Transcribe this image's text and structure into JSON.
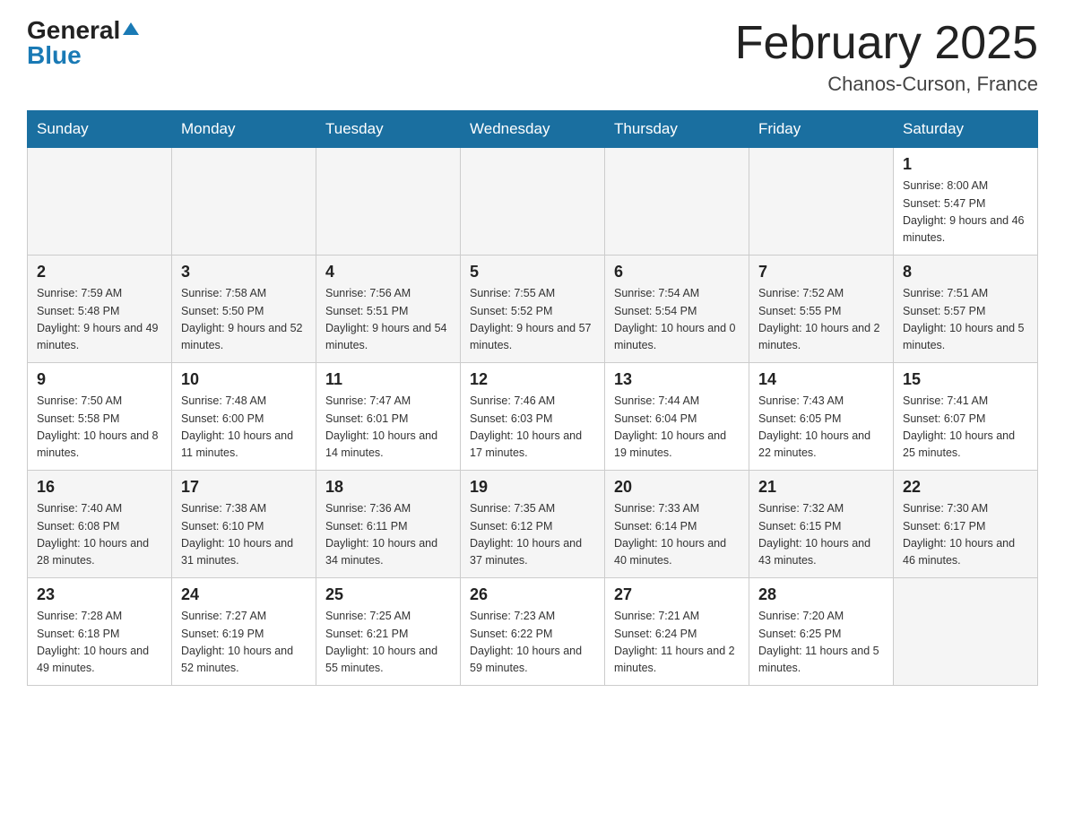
{
  "header": {
    "logo_general": "General",
    "logo_blue": "Blue",
    "title": "February 2025",
    "subtitle": "Chanos-Curson, France"
  },
  "weekdays": [
    "Sunday",
    "Monday",
    "Tuesday",
    "Wednesday",
    "Thursday",
    "Friday",
    "Saturday"
  ],
  "weeks": [
    [
      {
        "day": "",
        "info": ""
      },
      {
        "day": "",
        "info": ""
      },
      {
        "day": "",
        "info": ""
      },
      {
        "day": "",
        "info": ""
      },
      {
        "day": "",
        "info": ""
      },
      {
        "day": "",
        "info": ""
      },
      {
        "day": "1",
        "info": "Sunrise: 8:00 AM\nSunset: 5:47 PM\nDaylight: 9 hours\nand 46 minutes."
      }
    ],
    [
      {
        "day": "2",
        "info": "Sunrise: 7:59 AM\nSunset: 5:48 PM\nDaylight: 9 hours\nand 49 minutes."
      },
      {
        "day": "3",
        "info": "Sunrise: 7:58 AM\nSunset: 5:50 PM\nDaylight: 9 hours\nand 52 minutes."
      },
      {
        "day": "4",
        "info": "Sunrise: 7:56 AM\nSunset: 5:51 PM\nDaylight: 9 hours\nand 54 minutes."
      },
      {
        "day": "5",
        "info": "Sunrise: 7:55 AM\nSunset: 5:52 PM\nDaylight: 9 hours\nand 57 minutes."
      },
      {
        "day": "6",
        "info": "Sunrise: 7:54 AM\nSunset: 5:54 PM\nDaylight: 10 hours\nand 0 minutes."
      },
      {
        "day": "7",
        "info": "Sunrise: 7:52 AM\nSunset: 5:55 PM\nDaylight: 10 hours\nand 2 minutes."
      },
      {
        "day": "8",
        "info": "Sunrise: 7:51 AM\nSunset: 5:57 PM\nDaylight: 10 hours\nand 5 minutes."
      }
    ],
    [
      {
        "day": "9",
        "info": "Sunrise: 7:50 AM\nSunset: 5:58 PM\nDaylight: 10 hours\nand 8 minutes."
      },
      {
        "day": "10",
        "info": "Sunrise: 7:48 AM\nSunset: 6:00 PM\nDaylight: 10 hours\nand 11 minutes."
      },
      {
        "day": "11",
        "info": "Sunrise: 7:47 AM\nSunset: 6:01 PM\nDaylight: 10 hours\nand 14 minutes."
      },
      {
        "day": "12",
        "info": "Sunrise: 7:46 AM\nSunset: 6:03 PM\nDaylight: 10 hours\nand 17 minutes."
      },
      {
        "day": "13",
        "info": "Sunrise: 7:44 AM\nSunset: 6:04 PM\nDaylight: 10 hours\nand 19 minutes."
      },
      {
        "day": "14",
        "info": "Sunrise: 7:43 AM\nSunset: 6:05 PM\nDaylight: 10 hours\nand 22 minutes."
      },
      {
        "day": "15",
        "info": "Sunrise: 7:41 AM\nSunset: 6:07 PM\nDaylight: 10 hours\nand 25 minutes."
      }
    ],
    [
      {
        "day": "16",
        "info": "Sunrise: 7:40 AM\nSunset: 6:08 PM\nDaylight: 10 hours\nand 28 minutes."
      },
      {
        "day": "17",
        "info": "Sunrise: 7:38 AM\nSunset: 6:10 PM\nDaylight: 10 hours\nand 31 minutes."
      },
      {
        "day": "18",
        "info": "Sunrise: 7:36 AM\nSunset: 6:11 PM\nDaylight: 10 hours\nand 34 minutes."
      },
      {
        "day": "19",
        "info": "Sunrise: 7:35 AM\nSunset: 6:12 PM\nDaylight: 10 hours\nand 37 minutes."
      },
      {
        "day": "20",
        "info": "Sunrise: 7:33 AM\nSunset: 6:14 PM\nDaylight: 10 hours\nand 40 minutes."
      },
      {
        "day": "21",
        "info": "Sunrise: 7:32 AM\nSunset: 6:15 PM\nDaylight: 10 hours\nand 43 minutes."
      },
      {
        "day": "22",
        "info": "Sunrise: 7:30 AM\nSunset: 6:17 PM\nDaylight: 10 hours\nand 46 minutes."
      }
    ],
    [
      {
        "day": "23",
        "info": "Sunrise: 7:28 AM\nSunset: 6:18 PM\nDaylight: 10 hours\nand 49 minutes."
      },
      {
        "day": "24",
        "info": "Sunrise: 7:27 AM\nSunset: 6:19 PM\nDaylight: 10 hours\nand 52 minutes."
      },
      {
        "day": "25",
        "info": "Sunrise: 7:25 AM\nSunset: 6:21 PM\nDaylight: 10 hours\nand 55 minutes."
      },
      {
        "day": "26",
        "info": "Sunrise: 7:23 AM\nSunset: 6:22 PM\nDaylight: 10 hours\nand 59 minutes."
      },
      {
        "day": "27",
        "info": "Sunrise: 7:21 AM\nSunset: 6:24 PM\nDaylight: 11 hours\nand 2 minutes."
      },
      {
        "day": "28",
        "info": "Sunrise: 7:20 AM\nSunset: 6:25 PM\nDaylight: 11 hours\nand 5 minutes."
      },
      {
        "day": "",
        "info": ""
      }
    ]
  ]
}
